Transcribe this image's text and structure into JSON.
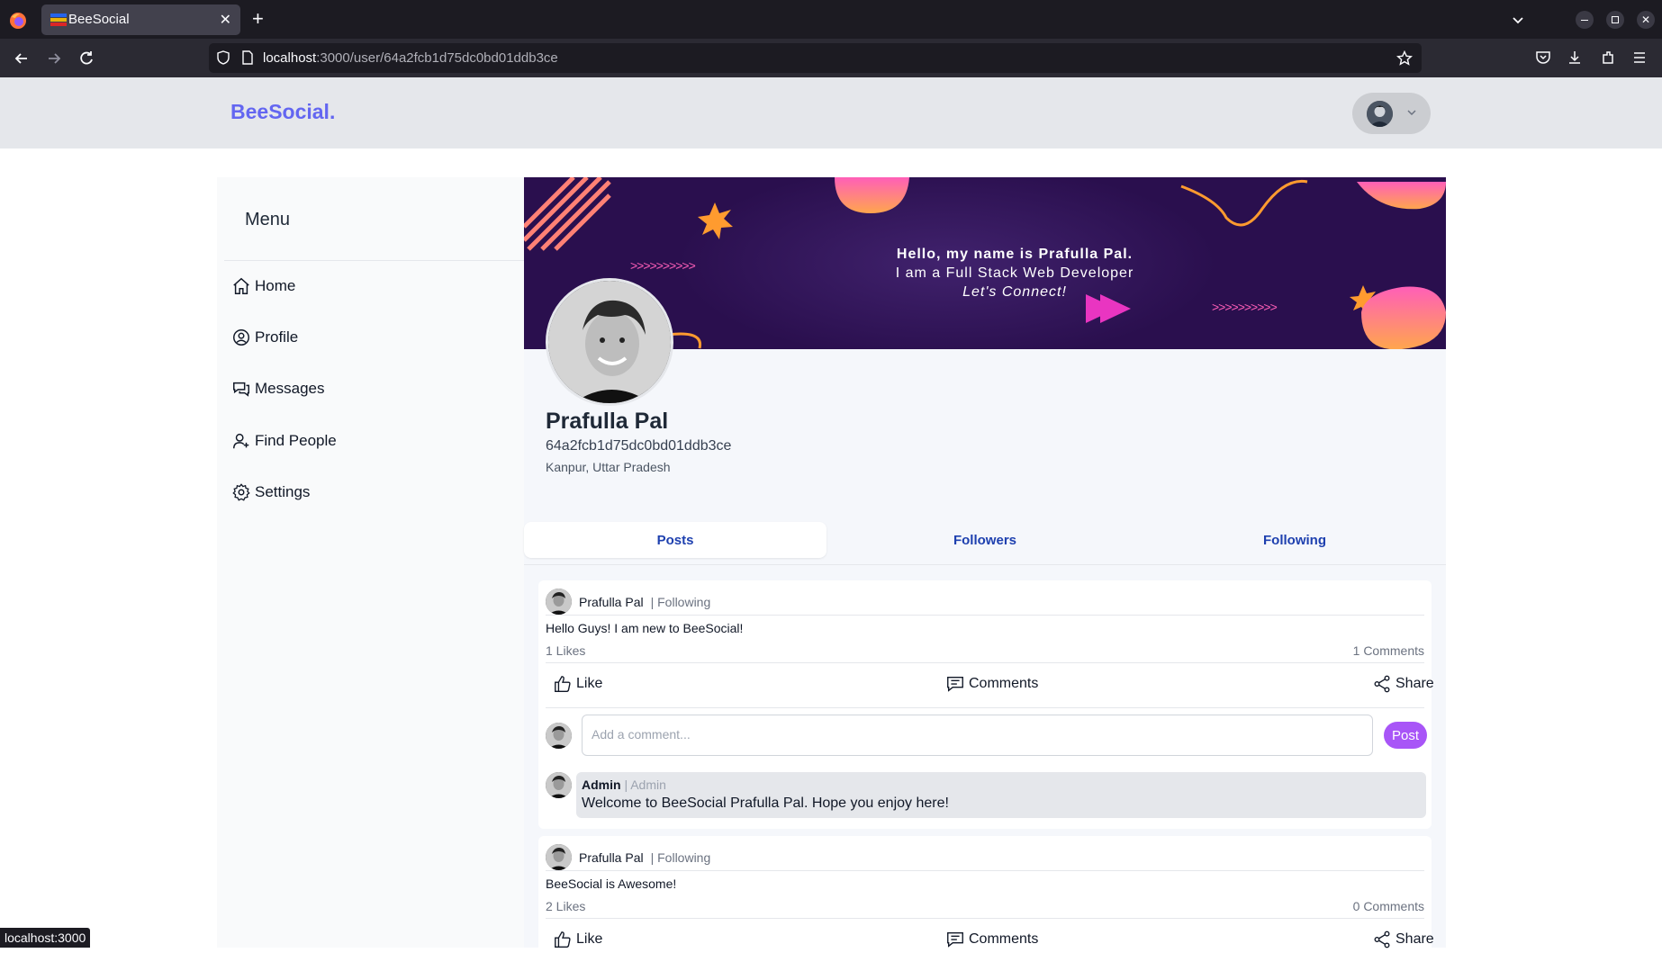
{
  "browser": {
    "tab_title": "BeeSocial",
    "url_host": "localhost",
    "url_rest": ":3000/user/64a2fcb1d75dc0bd01ddb3ce",
    "status_url": "localhost:3000"
  },
  "app": {
    "brand": "BeeSocial."
  },
  "sidebar": {
    "title": "Menu",
    "items": [
      {
        "label": "Home",
        "icon": "home-icon"
      },
      {
        "label": "Profile",
        "icon": "user-circle-icon"
      },
      {
        "label": "Messages",
        "icon": "chat-icon"
      },
      {
        "label": "Find People",
        "icon": "user-plus-icon"
      },
      {
        "label": "Settings",
        "icon": "gear-icon"
      }
    ]
  },
  "banner": {
    "line1": "Hello, my name is Prafulla Pal.",
    "line2": "I am a Full Stack Web Developer",
    "line3": "Let's Connect!",
    "chevrons": ">>>>>>>>>>"
  },
  "profile": {
    "name": "Prafulla Pal",
    "id": "64a2fcb1d75dc0bd01ddb3ce",
    "location": "Kanpur, Uttar Pradesh"
  },
  "tabs": [
    {
      "label": "Posts",
      "active": true
    },
    {
      "label": "Followers",
      "active": false
    },
    {
      "label": "Following",
      "active": false
    }
  ],
  "posts": [
    {
      "author": "Prafulla Pal",
      "relation": "| Following",
      "text": "Hello Guys! I am new to BeeSocial!",
      "likes": "1 Likes",
      "comments": "1 Comments",
      "like_label": "Like",
      "comments_label": "Comments",
      "share_label": "Share",
      "comment_placeholder": "Add a comment...",
      "post_button": "Post",
      "comment_list": [
        {
          "author": "Admin",
          "relation": "| Admin",
          "text": "Welcome to BeeSocial Prafulla Pal. Hope you enjoy here!"
        }
      ]
    },
    {
      "author": "Prafulla Pal",
      "relation": "| Following",
      "text": "BeeSocial is Awesome!",
      "likes": "2 Likes",
      "comments": "0 Comments",
      "like_label": "Like",
      "comments_label": "Comments",
      "share_label": "Share"
    }
  ]
}
